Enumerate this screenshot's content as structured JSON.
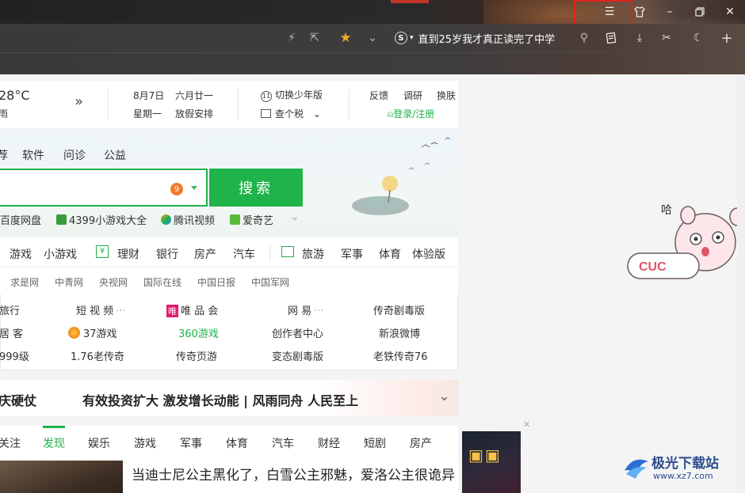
{
  "toolbar": {
    "news_ticker": "直到25岁我才真正读完了中学",
    "s_badge": "S"
  },
  "weather": {
    "temperature": "28°C",
    "condition": "雨"
  },
  "date": {
    "solar": "8月7日",
    "lunar": "六月廿一",
    "weekday": "星期一",
    "holiday": "放假安排"
  },
  "tools": {
    "youth_mode": "切换少年版",
    "tax": "查个税"
  },
  "user_links": {
    "feedback": "反馈",
    "survey": "调研",
    "skin": "换肤",
    "login": "登录/注册"
  },
  "search": {
    "tabs": [
      "软件",
      "问诊",
      "公益"
    ],
    "tab_prefix": "荐",
    "badge": "9",
    "button": "搜索",
    "quick_links": [
      "百度网盘",
      "4399小游戏大全",
      "腾讯视频",
      "爱奇艺"
    ]
  },
  "nav": {
    "row1": [
      "游戏",
      "小游戏",
      "理财",
      "银行",
      "房产",
      "汽车",
      "旅游",
      "军事",
      "体育",
      "体验版"
    ],
    "row2": [
      "求是网",
      "中青网",
      "央视网",
      "国际在线",
      "中国日报",
      "中国军网"
    ]
  },
  "link_grid": {
    "row1": [
      "旅行",
      "短 视 频",
      "唯 品 会",
      "网 易",
      "传奇剧毒版"
    ],
    "row2": [
      "居 客",
      "37游戏",
      "360游戏",
      "创作者中心",
      "新浪微博"
    ],
    "row3": [
      "999级",
      "1.76老传奇",
      "传奇页游",
      "变态剧毒版",
      "老铁传奇76"
    ],
    "highlight_color": "#1fb349"
  },
  "headline": {
    "left": "庆硬仗",
    "main": "有效投资扩大 激发增长动能 | 风雨同舟 人民至上"
  },
  "feed": {
    "tabs": [
      "关注",
      "发现",
      "娱乐",
      "游戏",
      "军事",
      "体育",
      "汽车",
      "财经",
      "短剧",
      "房产"
    ],
    "active_tab": "发现",
    "article_title": "当迪士尼公主黑化了，白雪公主邪魅，爱洛公主很诡异"
  },
  "mascot": {
    "text_top": "哈",
    "text_label": "CUC"
  },
  "watermark": {
    "brand": "极光下载站",
    "url": "www.xz7.com"
  },
  "colors": {
    "accent_green": "#1fb349",
    "highlight_red": "#e0231f",
    "star_orange": "#f5a623"
  }
}
